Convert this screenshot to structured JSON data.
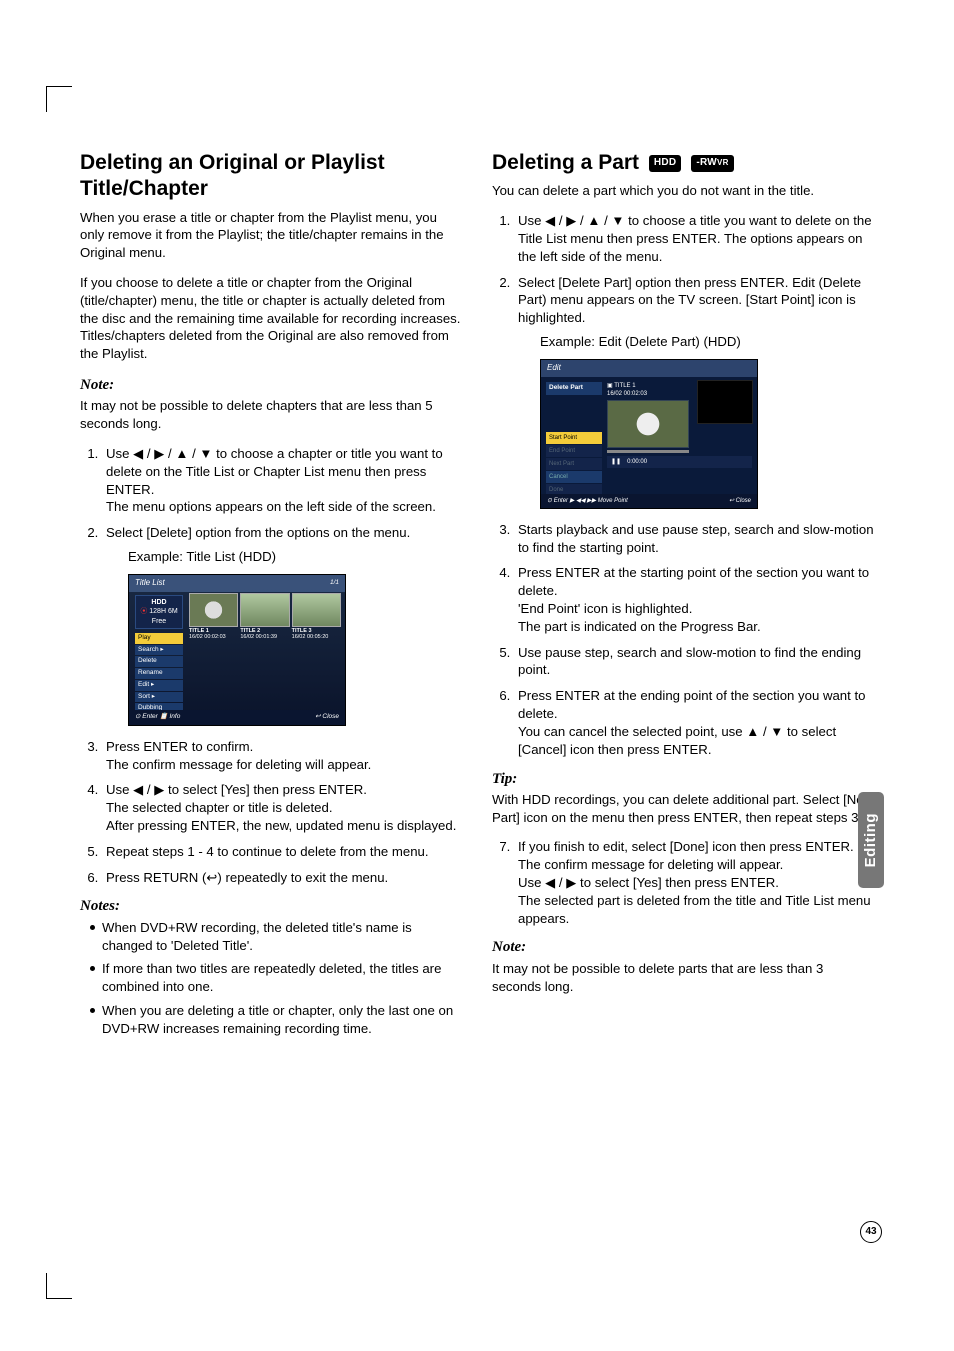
{
  "sideTab": "Editing",
  "pageNumber": "43",
  "left": {
    "h1": "Deleting an Original or Playlist Title/Chapter",
    "p1": "When you erase a title or chapter from the Playlist menu, you only remove it from the Playlist; the title/chapter remains in the Original menu.",
    "p2": "If you choose to delete a title or chapter from the Original (title/chapter) menu, the title or chapter is actually deleted from the disc and the remaining time available for recording increases. Titles/chapters deleted from the Original are also removed from the Playlist.",
    "noteHead1": "Note:",
    "note1": "It may not be possible to delete chapters that are less than 5 seconds long.",
    "steps": [
      {
        "a": "Use ◀ / ▶ / ▲ / ▼ to choose a chapter or title you want to delete on the Title List or Chapter List menu then press ENTER.",
        "b": "The menu options appears on the left side of the screen."
      },
      {
        "a": "Select [Delete] option from the options on the menu.",
        "ex": "Example: Title List (HDD)"
      },
      {
        "a": "Press ENTER to confirm.",
        "b": "The confirm message for deleting will appear."
      },
      {
        "a": "Use ◀ / ▶ to select [Yes] then press ENTER.",
        "b": "The selected chapter or title is deleted.",
        "c": "After pressing ENTER, the new, updated menu is displayed."
      },
      {
        "a": "Repeat steps 1 - 4 to continue to delete from the menu."
      },
      {
        "a": "Press RETURN (↩) repeatedly to exit the menu."
      }
    ],
    "notesHead": "Notes:",
    "notes": [
      "When DVD+RW recording, the deleted title's name is changed to 'Deleted Title'.",
      "If more than two titles are repeatedly deleted, the titles are combined into one.",
      "When you are deleting a title or chapter, only the last one on DVD+RW increases remaining recording time."
    ],
    "shot": {
      "title": "Title List",
      "page": "1/1",
      "hdd": "HDD",
      "rec": "⦿",
      "free": "128H 6M Free",
      "menu": [
        "Play",
        "Search ▸",
        "Delete",
        "Rename",
        "Edit ▸",
        "Sort ▸",
        "Dubbing"
      ],
      "thumbs": [
        {
          "t": "TITLE 1",
          "d": "16/02  00:02:03"
        },
        {
          "t": "TITLE 2",
          "d": "16/02  00:01:39"
        },
        {
          "t": "TITLE 3",
          "d": "16/02  00:05:20"
        }
      ],
      "barL": "⊙ Enter  📋 Info",
      "barR": "↩ Close"
    }
  },
  "right": {
    "h1": "Deleting a Part",
    "badge1": "HDD",
    "badge2": "-RW",
    "badge2sub": "VR",
    "p1": "You can delete a part which you do not want in the title.",
    "steps1": [
      "Use ◀ / ▶ / ▲ / ▼ to choose a title you want to delete on the Title List menu then press ENTER. The options appears on the left side of the menu.",
      {
        "a": "Select [Delete Part] option then press ENTER. Edit (Delete Part) menu appears on the TV screen. [Start Point] icon is highlighted.",
        "ex": "Example: Edit (Delete Part) (HDD)"
      }
    ],
    "steps2": [
      "Starts playback and use pause step, search and slow-motion to find the starting point.",
      {
        "a": "Press ENTER at the starting point of the section you want to delete.",
        "b": "'End Point' icon is highlighted.",
        "c": "The part is indicated on the Progress Bar."
      },
      "Use pause step, search and slow-motion to find the ending point.",
      {
        "a": "Press ENTER at the ending point of the section you want to delete.",
        "b": "You can cancel the selected point, use ▲ / ▼ to select [Cancel] icon then press ENTER."
      }
    ],
    "tipHead": "Tip:",
    "tip": "With HDD recordings, you can delete additional part. Select [Next Part] icon on the menu then press ENTER, then repeat steps 3-6.",
    "steps3": [
      {
        "a": "If you finish to edit, select [Done] icon then press ENTER.",
        "b": "The confirm message for deleting will appear.",
        "c": "Use ◀ / ▶ to select [Yes] then press ENTER.",
        "d": "The selected part is deleted from the title and Title List menu appears."
      }
    ],
    "noteHead": "Note:",
    "note": "It may not be possible to delete parts that are less than 3 seconds long.",
    "shot": {
      "title": "Edit",
      "h": "Delete Part",
      "lab": "▣ TITLE 1",
      "lab2": "16/02  00:02:03",
      "opts": [
        "Start Point",
        "End Point",
        "Next Part",
        "Cancel",
        "Done"
      ],
      "ctrlPause": "❚❚",
      "ctrlTime": "0:00:00",
      "footL": "⊙ Enter   ▶ ◀◀ ▶▶ Move Point",
      "footR": "↩ Close"
    }
  }
}
